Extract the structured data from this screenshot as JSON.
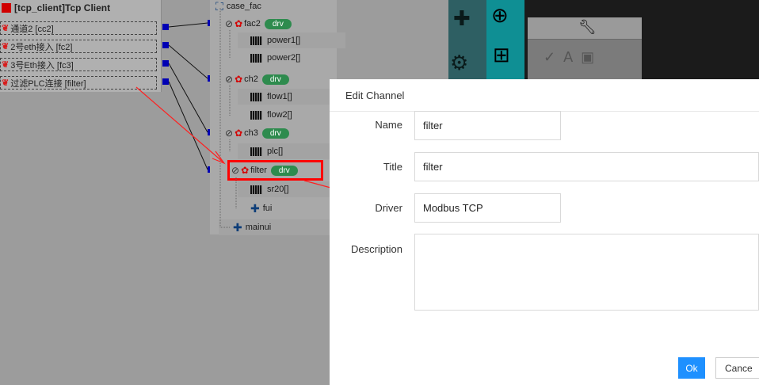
{
  "connector": {
    "title": "[tcp_client]Tcp Client",
    "link_glyph": "❦",
    "rows": [
      {
        "label": "通道2 [cc2]"
      },
      {
        "label": "2号eth接入 [fc2]"
      },
      {
        "label": "3号Eth接入 [fc3]"
      },
      {
        "label": "过滤PLC连接 [filter]"
      }
    ]
  },
  "tree": {
    "root": "case_fac",
    "drv_badge": "drv",
    "channels": [
      {
        "name": "fac2",
        "children": [
          "power1[]",
          "power2[]"
        ]
      },
      {
        "name": "ch2",
        "children": [
          "flow1[]",
          "flow2[]"
        ]
      },
      {
        "name": "ch3",
        "children": [
          "plc[]"
        ]
      },
      {
        "name": "filter",
        "children": [
          "sr20[]",
          "fui"
        ]
      }
    ],
    "bottom": "mainui"
  },
  "modal": {
    "title": "Edit Channel",
    "fields": {
      "name_label": "Name",
      "name_value": "filter",
      "title_label": "Title",
      "title_value": "filter",
      "driver_label": "Driver",
      "driver_value": "Modbus TCP",
      "description_label": "Description",
      "description_value": ""
    },
    "ok_label": "Ok",
    "cancel_label": "Cance"
  },
  "toolbar": {
    "icons": [
      "puzzle-icon",
      "crosshair-icon",
      "gears-icon",
      "plus-box-icon",
      "wrench-icon",
      "curve-icon",
      "text-icon",
      "image-icon"
    ]
  },
  "colors": {
    "drv_badge": "#2e8b4e",
    "port": "#0000b4",
    "highlight": "#ff0000",
    "ok_button": "#1e90ff",
    "link_icon": "#d81b1b"
  }
}
